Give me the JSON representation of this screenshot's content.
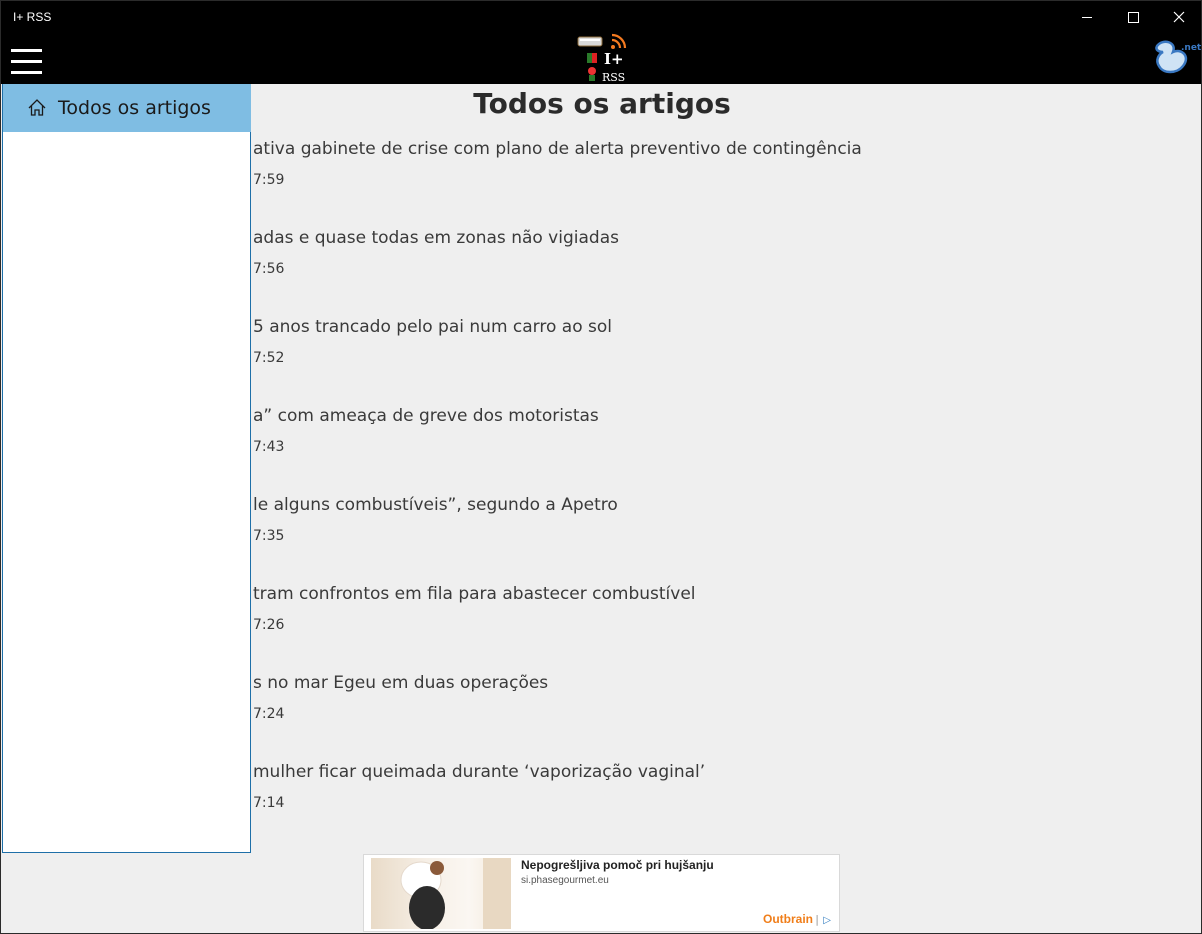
{
  "window": {
    "title": "I+ RSS"
  },
  "page": {
    "title": "Todos os artigos"
  },
  "nav": {
    "items": [
      {
        "label": "Todos os artigos",
        "icon": "home-icon",
        "selected": true
      }
    ]
  },
  "articles": [
    {
      "headline": "ativa gabinete de crise com plano de alerta preventivo de contingência",
      "time": "7:59"
    },
    {
      "headline": "adas e quase todas em zonas não vigiadas",
      "time": "7:56"
    },
    {
      "headline": "5 anos trancado pelo pai num carro ao sol",
      "time": "7:52"
    },
    {
      "headline": "a” com ameaça de greve dos motoristas",
      "time": "7:43"
    },
    {
      "headline": "le alguns combustíveis”, segundo a Apetro",
      "time": "7:35"
    },
    {
      "headline": "tram confrontos em fila para abastecer combustível",
      "time": "7:26"
    },
    {
      "headline": "s no mar Egeu em duas operações",
      "time": "7:24"
    },
    {
      "headline": "mulher ficar queimada durante ‘vaporização vaginal’",
      "time": "7:14"
    }
  ],
  "ad": {
    "title": "Nepogrešljiva pomoč pri hujšanju",
    "source": "si.phasegourmet.eu",
    "brand": "Outbrain",
    "separator": "|",
    "choices_icon": "▷"
  },
  "logo": {
    "text_top": "I+",
    "text_bottom": "RSS",
    "corner": ".net"
  },
  "colors": {
    "accent": "#7fbde3",
    "header": "#000000",
    "background": "#efefef",
    "rss": "#f47a20"
  }
}
